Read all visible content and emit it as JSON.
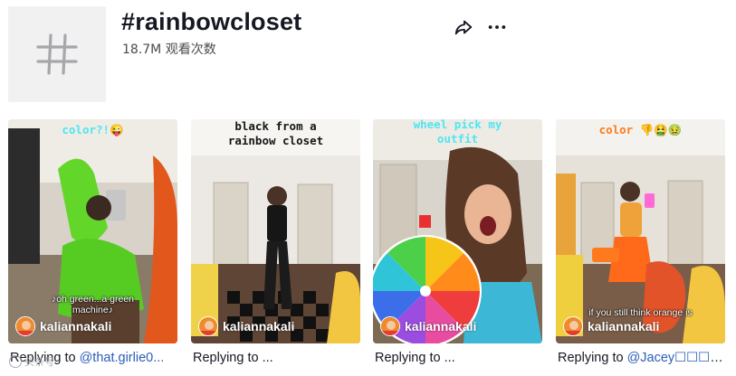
{
  "header": {
    "title": "#rainbowcloset",
    "views": "18.7M 观看次数",
    "avatar_icon": "hashtag-icon",
    "share_icon": "share-icon",
    "more_icon": "more-dots-icon"
  },
  "videos": [
    {
      "caption": "color?!😜",
      "overlay": "♪oh green...a green machine♪",
      "author": "kaliannakali",
      "desc_prefix": "Replying to ",
      "desc_mention": "@that.girlie0...",
      "desc_suffix": ""
    },
    {
      "caption": "black from a rainbow closet",
      "overlay": "",
      "author": "kaliannakali",
      "desc_prefix": "Replying to ...",
      "desc_mention": "",
      "desc_suffix": ""
    },
    {
      "caption": "wheel pick my outfit",
      "overlay": "",
      "author": "kaliannakali",
      "desc_prefix": "Replying to ...",
      "desc_mention": "",
      "desc_suffix": ""
    },
    {
      "caption": "color 👎🤮🤢",
      "overlay": "if you still think orange is",
      "author": "kaliannakali",
      "desc_prefix": "Replying to ",
      "desc_mention": "@Jacey☐☐☐",
      "desc_suffix": " i..."
    }
  ],
  "watermark": {
    "text": "头条号"
  },
  "colors": {
    "text": "#161823",
    "mention": "#2b5db9",
    "caption_cyan": "#4ee6f0",
    "caption_orange": "#ff7a1a"
  }
}
